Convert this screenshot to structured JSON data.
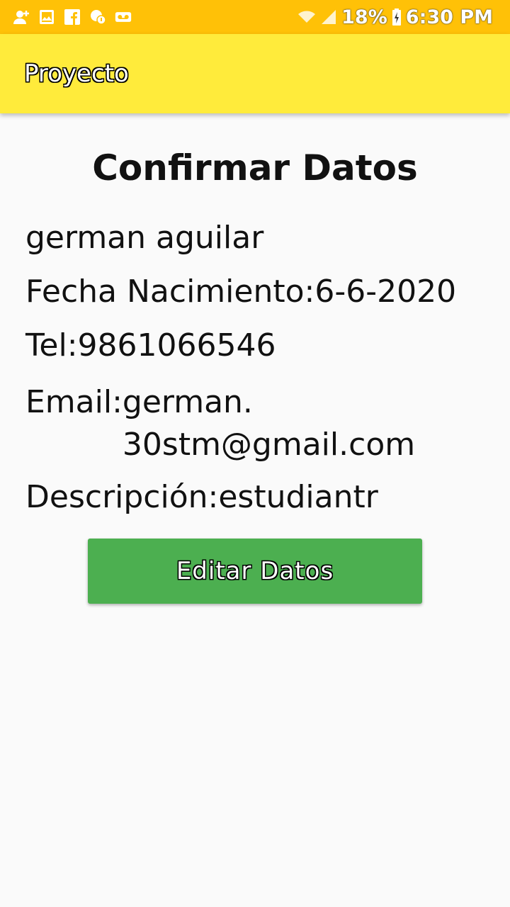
{
  "status_bar": {
    "battery_percent": "18%",
    "time": "6:30 PM",
    "left_icons": [
      "add-contact-icon",
      "gallery-icon",
      "facebook-icon",
      "chat-icon",
      "voicemail-icon"
    ],
    "right_icons": [
      "wifi-icon",
      "signal-icon",
      "battery-charging-icon"
    ],
    "color": "#ffc107"
  },
  "app_bar": {
    "title": "Proyecto",
    "color": "#ffeb3b"
  },
  "main": {
    "heading": "Confirmar Datos",
    "name": "german aguilar",
    "birth_label": "Fecha Nacimiento:",
    "birth_value": "6-6-2020",
    "phone_label": "Tel:",
    "phone_value": "9861066546",
    "email_label": "Email:",
    "email_line1": "german.",
    "email_line2": "30stm@gmail.com",
    "desc_label": "Descripción:",
    "desc_value": "estudiantr",
    "edit_button": "Editar Datos",
    "button_color": "#4caf50"
  }
}
